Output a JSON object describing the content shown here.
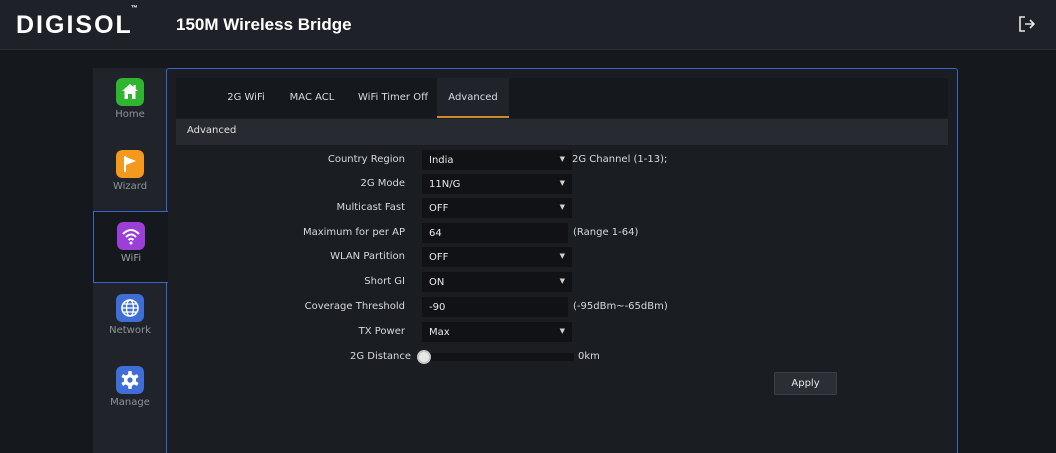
{
  "header": {
    "logo": "DIGISOL",
    "logo_tm": "™",
    "product_title": "150M Wireless Bridge",
    "logout_icon": "logout-icon"
  },
  "sidebar": {
    "items": [
      {
        "label": "Home",
        "icon": "home-icon",
        "color": "#2fb52f"
      },
      {
        "label": "Wizard",
        "icon": "flag-icon",
        "color": "#f39a1e"
      },
      {
        "label": "WiFi",
        "icon": "wifi-icon",
        "color": "#9b3fd6",
        "active": true
      },
      {
        "label": "Network",
        "icon": "globe-icon",
        "color": "#3f6fd6"
      },
      {
        "label": "Manage",
        "icon": "gear-icon",
        "color": "#3f6fd6"
      }
    ]
  },
  "tabs": [
    {
      "label": "2G WiFi"
    },
    {
      "label": "MAC ACL"
    },
    {
      "label": "WiFi Timer Off"
    },
    {
      "label": "Advanced",
      "active": true
    }
  ],
  "section_title": "Advanced",
  "form": {
    "country_region": {
      "label": "Country Region",
      "value": "India",
      "hint": "2G Channel (1-13);"
    },
    "mode_2g": {
      "label": "2G Mode",
      "value": "11N/G"
    },
    "multicast_fast": {
      "label": "Multicast Fast",
      "value": "OFF"
    },
    "max_per_ap": {
      "label": "Maximum for per AP",
      "value": "64",
      "hint": "(Range 1-64)"
    },
    "wlan_partition": {
      "label": "WLAN Partition",
      "value": "OFF"
    },
    "short_gi": {
      "label": "Short GI",
      "value": "ON"
    },
    "coverage_threshold": {
      "label": "Coverage Threshold",
      "value": "-90",
      "hint": "(-95dBm~-65dBm)"
    },
    "tx_power": {
      "label": "TX Power",
      "value": "Max"
    },
    "distance_2g": {
      "label": "2G Distance",
      "value": "0km",
      "level": 0
    }
  },
  "apply_label": "Apply",
  "accent": "#3c63c8",
  "tab_active_color": "#c98a2c"
}
